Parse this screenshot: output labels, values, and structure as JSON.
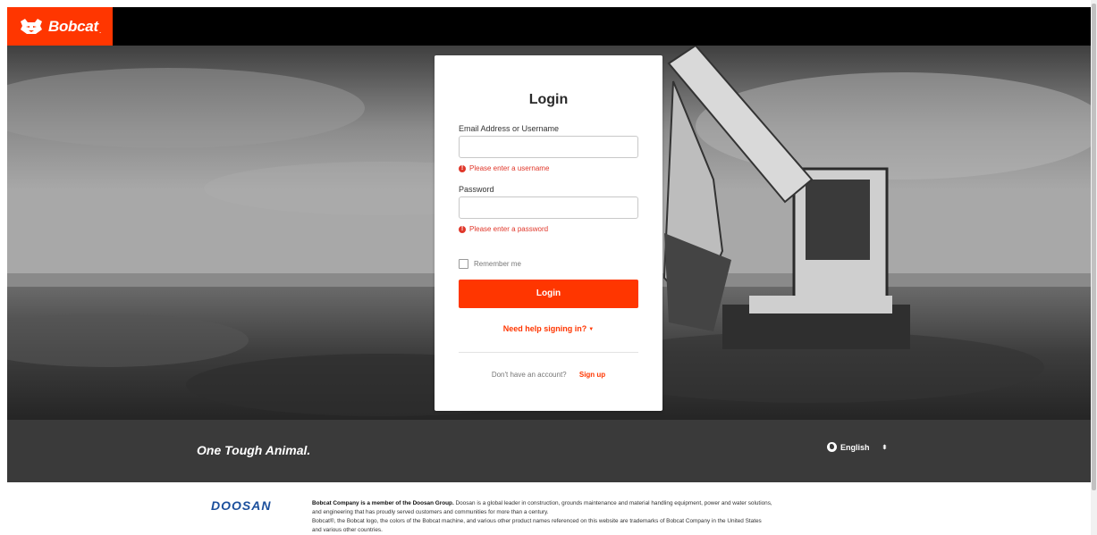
{
  "header": {
    "brand": "Bobcat",
    "brand_mark": "."
  },
  "login": {
    "title": "Login",
    "username_label": "Email Address or Username",
    "username_value": "",
    "username_error": "Please enter a username",
    "password_label": "Password",
    "password_value": "",
    "password_error": "Please enter a password",
    "remember_label": "Remember me",
    "remember_checked": false,
    "submit_label": "Login",
    "help_label": "Need help signing in?",
    "no_account_text": "Don't have an account?",
    "signup_label": "Sign up"
  },
  "footer": {
    "tagline": "One Tough Animal.",
    "language": "English",
    "partner_logo": "DOOSAN",
    "legal_bold": "Bobcat Company is a member of the Doosan Group.",
    "legal_line1": " Doosan is a global leader in construction, grounds maintenance and material handling equipment, power and water solutions,",
    "legal_line2": "and engineering that has proudly served customers and communities for more than a century.",
    "legal_line3": "Bobcat®, the Bobcat logo, the colors of the Bobcat machine, and various other product names referenced on this website are trademarks of Bobcat Company in the United States",
    "legal_line4": "and various other countries."
  },
  "colors": {
    "brand": "#ff3600",
    "error": "#e0372a",
    "doosan": "#1b4f9c",
    "band": "#3a3a3a"
  },
  "icons": [
    "bobcat-logo-icon",
    "error-icon",
    "checkbox-icon",
    "caret-down-icon",
    "globe-icon",
    "select-arrows-icon"
  ]
}
